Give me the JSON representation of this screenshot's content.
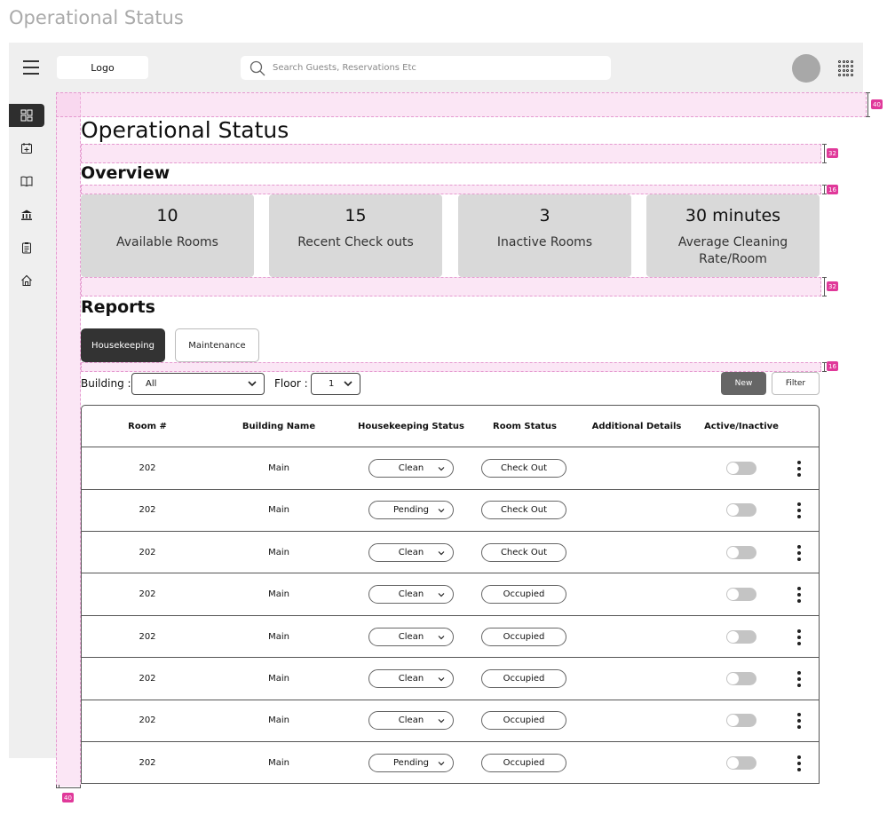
{
  "frame_title": "Operational Status",
  "header": {
    "logo": "Logo",
    "search_placeholder": "Search Guests, Reservations Etc"
  },
  "sidebar": {
    "items": [
      {
        "icon": "dashboard-icon",
        "active": true
      },
      {
        "icon": "calendar-add-icon",
        "active": false
      },
      {
        "icon": "book-icon",
        "active": false
      },
      {
        "icon": "bank-icon",
        "active": false
      },
      {
        "icon": "clipboard-icon",
        "active": false
      },
      {
        "icon": "home-icon",
        "active": false
      }
    ]
  },
  "spacing_tags": [
    "40",
    "32",
    "16",
    "32",
    "16",
    "40"
  ],
  "page_title": "Operational Status",
  "overview": {
    "title": "Overview",
    "cards": [
      {
        "value": "10",
        "label": "Available Rooms"
      },
      {
        "value": "15",
        "label": "Recent Check outs"
      },
      {
        "value": "3",
        "label": "Inactive Rooms"
      },
      {
        "value": "30 minutes",
        "label": "Average Cleaning Rate/Room"
      }
    ]
  },
  "reports": {
    "title": "Reports",
    "tabs": [
      {
        "label": "Housekeeping",
        "active": true
      },
      {
        "label": "Maintenance",
        "active": false
      }
    ],
    "filters": {
      "building_label": "Building :",
      "building_value": "All",
      "floor_label": "Floor :",
      "floor_value": "1"
    },
    "new_label": "New",
    "filter_label": "Filter",
    "columns": [
      "Room #",
      "Building Name",
      "Housekeeping Status",
      "Room Status",
      "Additional Details",
      "Active/Inactive"
    ],
    "rows": [
      {
        "room": "202",
        "building": "Main",
        "housekeeping": "Clean",
        "status": "Check Out",
        "details": "",
        "active": false
      },
      {
        "room": "202",
        "building": "Main",
        "housekeeping": "Pending",
        "status": "Check Out",
        "details": "",
        "active": false
      },
      {
        "room": "202",
        "building": "Main",
        "housekeeping": "Clean",
        "status": "Check Out",
        "details": "",
        "active": false
      },
      {
        "room": "202",
        "building": "Main",
        "housekeeping": "Clean",
        "status": "Occupied",
        "details": "",
        "active": false
      },
      {
        "room": "202",
        "building": "Main",
        "housekeeping": "Clean",
        "status": "Occupied",
        "details": "",
        "active": false
      },
      {
        "room": "202",
        "building": "Main",
        "housekeeping": "Clean",
        "status": "Occupied",
        "details": "",
        "active": false
      },
      {
        "room": "202",
        "building": "Main",
        "housekeeping": "Clean",
        "status": "Occupied",
        "details": "",
        "active": false
      },
      {
        "room": "202",
        "building": "Main",
        "housekeeping": "Pending",
        "status": "Occupied",
        "details": "",
        "active": false
      }
    ]
  },
  "colors": {
    "accent_dark": "#333333",
    "guide_pink": "#e0399a",
    "card_bg": "#d9d9d9"
  }
}
